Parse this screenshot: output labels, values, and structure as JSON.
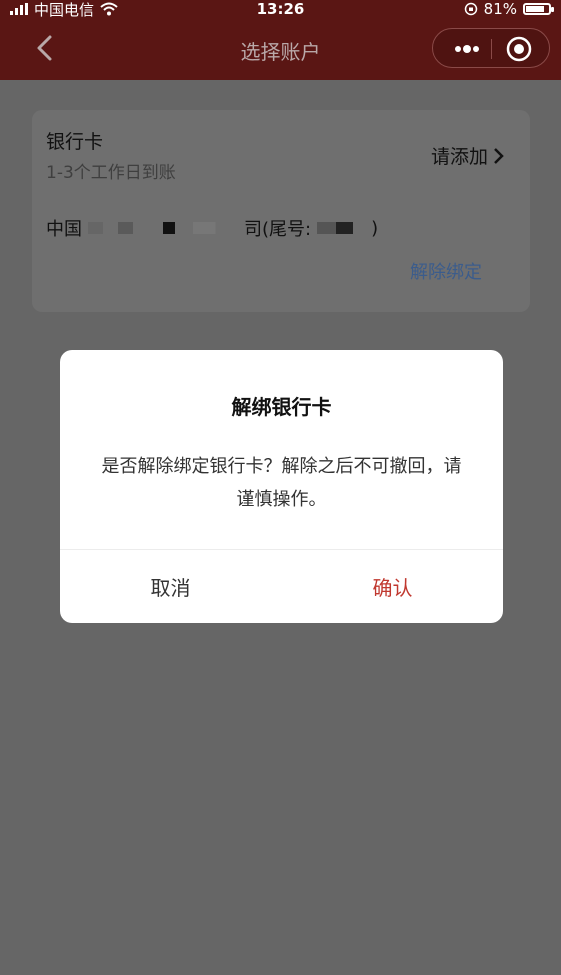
{
  "statusbar": {
    "carrier": "中国电信",
    "time": "13:26",
    "battery": "81%",
    "battery_fraction": 0.81
  },
  "navbar": {
    "title": "选择账户"
  },
  "bank_card": {
    "title": "银行卡",
    "subtitle": "1-3个工作日到账",
    "add_label": "请添加",
    "bank_prefix": "中国",
    "bank_suffix": "司(尾号:",
    "bank_close": ")",
    "unbind_label": "解除绑定"
  },
  "dialog": {
    "title": "解绑银行卡",
    "message": "是否解除绑定银行卡？解除之后不可撤回，请谨慎操作。",
    "cancel_label": "取消",
    "confirm_label": "确认"
  },
  "colors": {
    "nav_bg": "#5a1614",
    "confirm": "#c0382f",
    "link": "#3b5c8c",
    "overlay": "#666666"
  }
}
